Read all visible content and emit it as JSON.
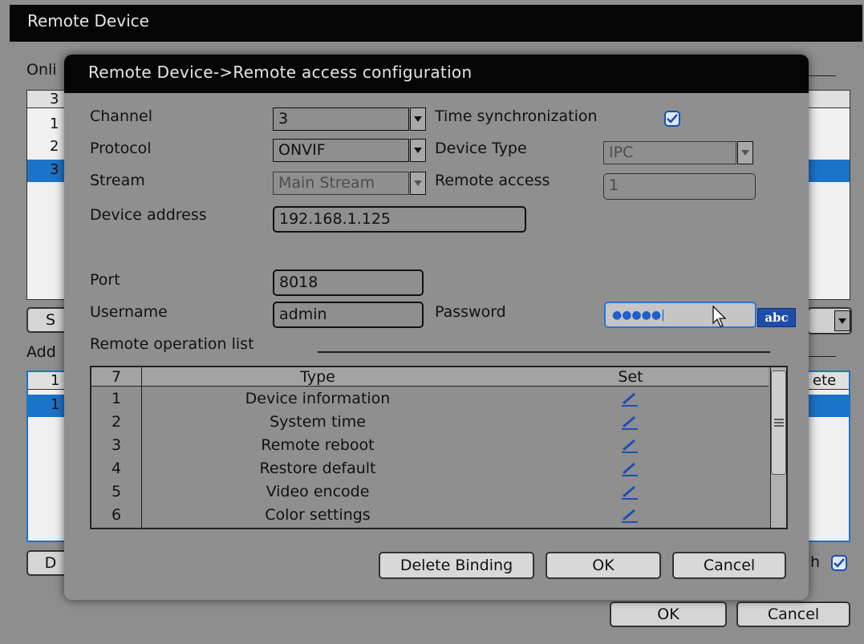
{
  "background": {
    "title": "Remote Device",
    "online_label": "Onli",
    "add_label": "Add",
    "online_list": {
      "header": "3",
      "rows": [
        "1",
        "2",
        "3"
      ]
    },
    "added_list": {
      "header": "1",
      "rows": [
        "1"
      ],
      "right_header": "ete"
    },
    "search_button": "S",
    "delete_button": "D",
    "sync_label": "h",
    "ok_button": "OK",
    "cancel_button": "Cancel"
  },
  "dialog": {
    "title": "Remote Device->Remote access configuration",
    "channel": {
      "label": "Channel",
      "value": "3"
    },
    "protocol": {
      "label": "Protocol",
      "value": "ONVIF"
    },
    "stream": {
      "label": "Stream",
      "value": "Main Stream"
    },
    "time_sync": {
      "label": "Time synchronization",
      "checked": true
    },
    "device_type": {
      "label": "Device Type",
      "value": "IPC"
    },
    "remote_access": {
      "label": "Remote access",
      "value": "1"
    },
    "device_address": {
      "label": "Device address",
      "value": "192.168.1.125"
    },
    "port": {
      "label": "Port",
      "value": "8018"
    },
    "username": {
      "label": "Username",
      "value": "admin"
    },
    "password": {
      "label": "Password",
      "value": "●●●●●|"
    },
    "keyboard_button": "abc",
    "ops_list_label": "Remote operation list",
    "table": {
      "count": "7",
      "col_type": "Type",
      "col_set": "Set",
      "rows": [
        {
          "num": "1",
          "type": "Device information"
        },
        {
          "num": "2",
          "type": "System time"
        },
        {
          "num": "3",
          "type": "Remote reboot"
        },
        {
          "num": "4",
          "type": "Restore default"
        },
        {
          "num": "5",
          "type": "Video encode"
        },
        {
          "num": "6",
          "type": "Color settings"
        }
      ]
    },
    "buttons": {
      "delete_binding": "Delete Binding",
      "ok": "OK",
      "cancel": "Cancel"
    }
  },
  "colors": {
    "accent": "#1c74c9",
    "titlebar": "#050505",
    "panel": "#8f8f8f"
  }
}
